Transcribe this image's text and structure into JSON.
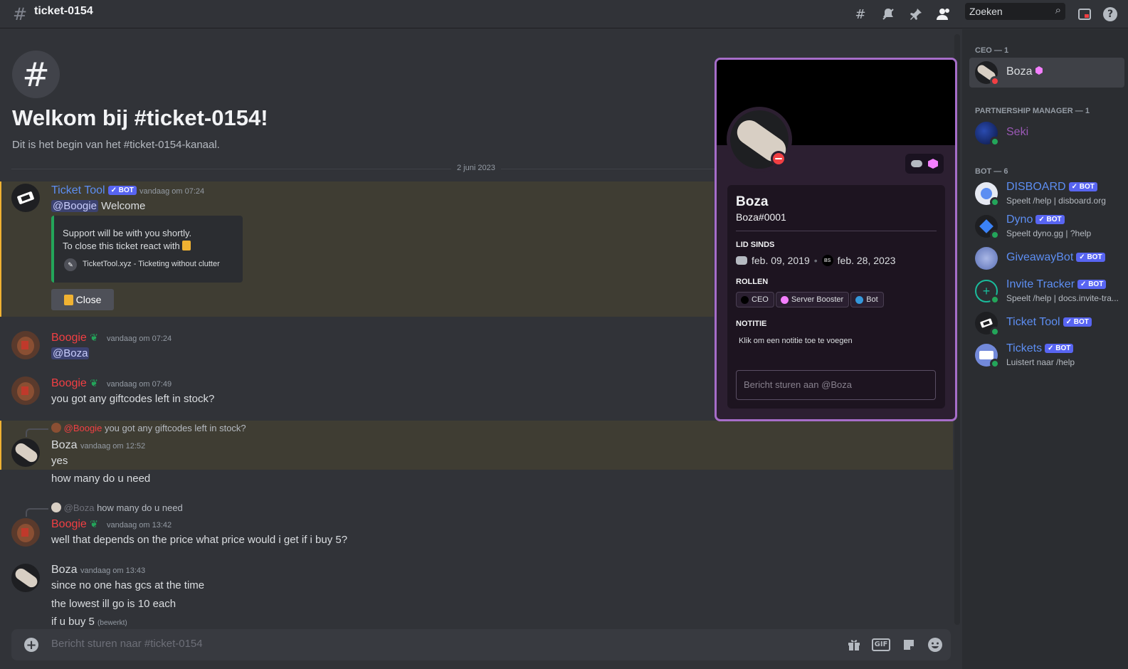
{
  "header": {
    "channel_name": "ticket-0154",
    "search_placeholder": "Zoeken",
    "icons": [
      "threads-icon",
      "mute-notifications-icon",
      "pin-icon",
      "member-list-icon",
      "inbox-icon",
      "help-icon"
    ]
  },
  "welcome": {
    "title": "Welkom bij #ticket-0154!",
    "subtitle": "Dit is het begin van het #ticket-0154-kanaal."
  },
  "date_divider": "2 juni 2023",
  "messages": [
    {
      "author": "Ticket Tool",
      "bot": "BOT",
      "timestamp": "vandaag om 07:24",
      "mention": "@Boogie",
      "text": "Welcome",
      "embed": {
        "line1": "Support will be with you shortly.",
        "line2": "To close this ticket react with",
        "footer": "TicketTool.xyz - Ticketing without clutter"
      },
      "button": "Close"
    },
    {
      "author": "Boogie",
      "timestamp": "vandaag om 07:24",
      "mention": "@Boza"
    },
    {
      "author": "Boogie",
      "timestamp": "vandaag om 07:49",
      "text": "you got any giftcodes left in stock?"
    },
    {
      "reply_author": "@Boogie",
      "reply_text": "you got any giftcodes left in stock?",
      "author": "Boza",
      "timestamp": "vandaag om 12:52",
      "lines": [
        "yes",
        "how many do u need"
      ]
    },
    {
      "reply_author": "@Boza",
      "reply_text": "how many do u need",
      "author": "Boogie",
      "timestamp": "vandaag om 13:42",
      "text": "well that depends on the price what price would i get if i buy 5?"
    },
    {
      "author": "Boza",
      "timestamp": "vandaag om 13:43",
      "lines": [
        "since no one has gcs at the time",
        "the lowest ill go is 10 each",
        "if u buy 5"
      ],
      "edited": "(bewerkt)"
    }
  ],
  "composer": {
    "placeholder": "Bericht sturen naar #ticket-0154",
    "gif_label": "GIF"
  },
  "profile": {
    "name": "Boza",
    "tag": "Boza#0001",
    "member_since_heading": "LID SINDS",
    "discord_date": "feb. 09, 2019",
    "server_date": "feb. 28, 2023",
    "server_icon_text": "BS",
    "roles_heading": "ROLLEN",
    "roles": [
      {
        "name": "CEO",
        "color": "#000000"
      },
      {
        "name": "Server Booster",
        "color": "#f47fff"
      },
      {
        "name": "Bot",
        "color": "#3498db"
      }
    ],
    "note_heading": "NOTITIE",
    "note_placeholder": "Klik om een notitie toe te voegen",
    "message_placeholder": "Bericht sturen aan @Boza"
  },
  "members": {
    "categories": [
      {
        "label": "CEO — 1"
      },
      {
        "label": "PARTNERSHIP MANAGER — 1"
      },
      {
        "label": "BOT — 6"
      }
    ],
    "list": [
      {
        "name": "Boza",
        "color": "#dbdee1",
        "status": "#f23f43"
      },
      {
        "name": "Seki",
        "color": "#9b59b6",
        "status": "#23a55a"
      },
      {
        "name": "DISBOARD",
        "bot": "BOT",
        "color": "#5d8ef2",
        "sub": "Speelt /help | disboard.org",
        "status": "#23a55a"
      },
      {
        "name": "Dyno",
        "bot": "BOT",
        "color": "#5d8ef2",
        "sub": "Speelt dyno.gg | ?help",
        "status": "#23a55a"
      },
      {
        "name": "GiveawayBot",
        "bot": "BOT",
        "color": "#5d8ef2",
        "status": "#23a55a"
      },
      {
        "name": "Invite Tracker",
        "bot": "BOT",
        "color": "#5d8ef2",
        "sub": "Speelt /help | docs.invite-tra...",
        "status": "#23a55a"
      },
      {
        "name": "Ticket Tool",
        "bot": "BOT",
        "color": "#5d8ef2",
        "status": "#23a55a"
      },
      {
        "name": "Tickets",
        "bot": "BOT",
        "color": "#5d8ef2",
        "sub": "Luistert naar /help",
        "status": "#23a55a"
      }
    ]
  },
  "colors": {
    "boogie": "#f23f43",
    "ticket_tool": "#5d8ef2",
    "accent": "#5865f2",
    "profile_border": "#a66dc9"
  }
}
